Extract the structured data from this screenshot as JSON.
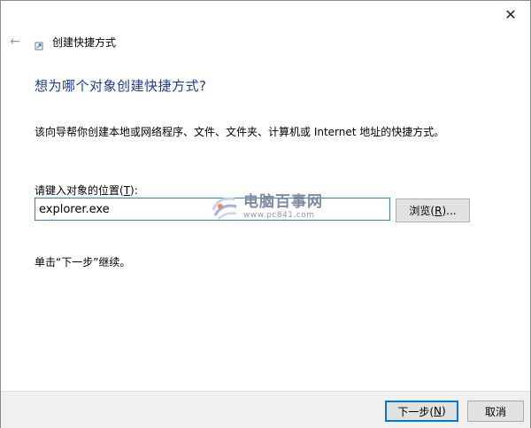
{
  "window": {
    "close_glyph": "✕"
  },
  "header": {
    "back_glyph": "←",
    "title": "创建快捷方式"
  },
  "main": {
    "heading": "想为哪个对象创建快捷方式?",
    "description": "该向导帮你创建本地或网络程序、文件、文件夹、计算机或 Internet 地址的快捷方式。",
    "field_label_prefix": "请键入对象的位置(",
    "field_label_key": "T",
    "field_label_suffix": "):",
    "location_value": "explorer.exe",
    "browse_prefix": "浏览(",
    "browse_key": "R",
    "browse_suffix": ")...",
    "hint": "单击“下一步”继续。"
  },
  "footer": {
    "next_prefix": "下一步(",
    "next_key": "N",
    "next_suffix": ")",
    "cancel_label": "取消"
  },
  "watermark": {
    "main": "电脑百事网",
    "sub": "www.pc841.com"
  },
  "colors": {
    "heading": "#1a3e8c",
    "accent": "#0078d7",
    "footer_bg": "#f0f0f0"
  }
}
